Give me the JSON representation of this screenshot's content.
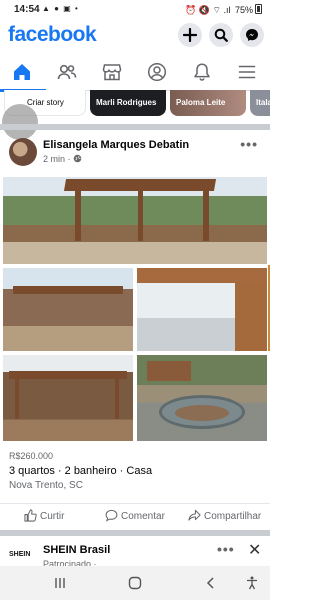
{
  "status_bar": {
    "time": "14:54",
    "left_icons": "▲ ● ▣ •",
    "right_icons": "⏰ 🔇 ⌔ .ıl",
    "battery": "75%"
  },
  "header": {
    "logo": "facebook",
    "buttons": [
      "add-icon",
      "search-icon",
      "messenger-icon"
    ]
  },
  "tabs": [
    "home-icon",
    "friends-icon",
    "marketplace-icon",
    "profile-icon",
    "notifications-icon",
    "menu-icon"
  ],
  "stories": {
    "create_label": "Criar story",
    "items": [
      "Marli Rodrigues",
      "Paloma Leite",
      "Itala"
    ]
  },
  "post": {
    "author": "Elisangela Marques Debatin",
    "time": "2 min ·",
    "more": "•••",
    "price": "R$260.000",
    "title": "3 quartos · 2 banheiro · Casa",
    "location": "Nova Trento, SC"
  },
  "actions": {
    "like": "Curtir",
    "comment": "Comentar",
    "share": "Compartilhar"
  },
  "next_post": {
    "logo_text": "SHEIN",
    "name": "SHEIN Brasil",
    "sponsored": "Patrocinado ·",
    "more": "•••",
    "close": "✕"
  },
  "colors": {
    "brand": "#1877f2",
    "secondary_text": "#65676b",
    "separator": "#c9ccd1"
  }
}
